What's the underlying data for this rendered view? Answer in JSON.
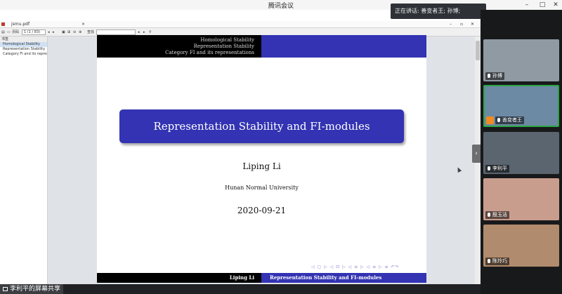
{
  "window": {
    "title": "腾讯会议",
    "minimize_glyph": "–",
    "maximize_glyph": "□",
    "close_glyph": "✕"
  },
  "speaking": {
    "text": "正在讲话: 善变者王; 孙博;"
  },
  "participants": [
    {
      "name": "孙博",
      "bg": "#8f9aa3"
    },
    {
      "name": "善变者王",
      "bg": "#6d8aa4"
    },
    {
      "name": "李利平",
      "bg": "#5a6570"
    },
    {
      "name": "殷玉洁",
      "bg": "#c99d8e"
    },
    {
      "name": "陈玲巧",
      "bg": "#b08b6d"
    }
  ],
  "sidebar_toggle": {
    "glyph": "›"
  },
  "pdf_reader": {
    "tab_title": "jsmu.pdf",
    "toolbar": {
      "page_label": "页码",
      "page_value": "1 (1 / 83)",
      "search_label": "查找"
    },
    "outline_header": "书签",
    "outline": [
      "Homological Stability",
      "Representation Stability",
      "Category FI and its representations"
    ]
  },
  "slide": {
    "header_lines": [
      "Homological Stability",
      "Representation Stability",
      "Category FI and its representations"
    ],
    "title": "Representation Stability and FI-modules",
    "author": "Liping Li",
    "institution": "Hunan Normal University",
    "date": "2020-09-21",
    "nav_symbols": "◁ ▢ ▷ ◁ ⊡ ▷ ◁ ≡ ▷ ◁ ≡ ▷ ≡ ↶↷",
    "footer_left": "Liping Li",
    "footer_right": "Representation Stability and FI-modules"
  },
  "screen_share": {
    "label": "李利平的屏幕共享"
  },
  "colors": {
    "beamer_blue": "#3333b3",
    "panel_bg": "#18191b",
    "active_border": "#2aa744"
  }
}
